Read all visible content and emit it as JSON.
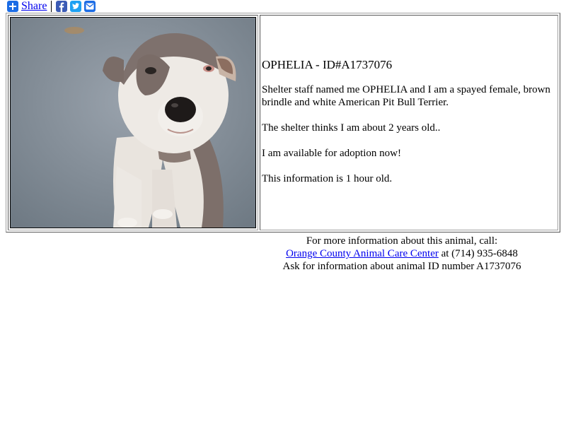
{
  "share": {
    "label": "Share",
    "icons": [
      "plus-icon",
      "facebook-icon",
      "twitter-icon",
      "email-icon"
    ],
    "brand_color": "#1b6ce5"
  },
  "animal": {
    "heading": "OPHELIA - ID#A1737076",
    "paragraph_1": "Shelter staff named me OPHELIA and I am a spayed female, brown brindle and white American Pit Bull Terrier.",
    "paragraph_2": "The shelter thinks I am about 2 years old..",
    "paragraph_3": "I am available for adoption now!",
    "paragraph_4": "This information is 1 hour old."
  },
  "contact": {
    "line1": "For more information about this animal, call:",
    "shelter_link": "Orange County Animal Care Center",
    "phone_text": " at (714) 935-6848",
    "line3": "Ask for information about animal ID number A1737076"
  },
  "colors": {
    "link": "#0000ee",
    "text": "#000000"
  }
}
